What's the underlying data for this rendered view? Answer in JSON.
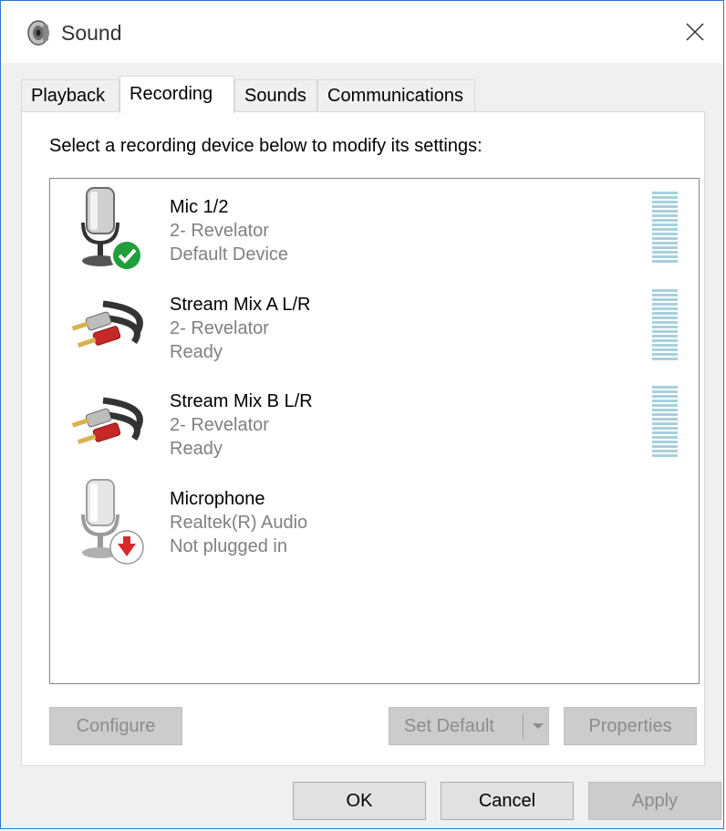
{
  "window": {
    "title": "Sound",
    "title_icon": "speaker-icon",
    "close_icon": "close-icon"
  },
  "tabs": [
    {
      "label": "Playback",
      "active": false
    },
    {
      "label": "Recording",
      "active": true
    },
    {
      "label": "Sounds",
      "active": false
    },
    {
      "label": "Communications",
      "active": false
    }
  ],
  "panel": {
    "instruction": "Select a recording device below to modify its settings:"
  },
  "devices": [
    {
      "name": "Mic 1/2",
      "sub": "2- Revelator",
      "status": "Default Device",
      "icon": "microphone-icon",
      "badge": "default-check-icon",
      "meter": true
    },
    {
      "name": "Stream Mix A L/R",
      "sub": "2- Revelator",
      "status": "Ready",
      "icon": "rca-cable-icon",
      "badge": "",
      "meter": true
    },
    {
      "name": "Stream Mix B L/R",
      "sub": "2- Revelator",
      "status": "Ready",
      "icon": "rca-cable-icon",
      "badge": "",
      "meter": true
    },
    {
      "name": "Microphone",
      "sub": "Realtek(R) Audio",
      "status": "Not plugged in",
      "icon": "microphone-icon",
      "badge": "unplugged-arrow-icon",
      "meter": false
    }
  ],
  "buttons": {
    "configure": "Configure",
    "set_default": "Set Default",
    "properties": "Properties"
  },
  "footer": {
    "ok": "OK",
    "cancel": "Cancel",
    "apply": "Apply"
  },
  "colors": {
    "window_border": "#2b78c6",
    "check_green": "#1f9e3a",
    "unplugged_red": "#d8282a",
    "meter": "#a8d0dc"
  }
}
